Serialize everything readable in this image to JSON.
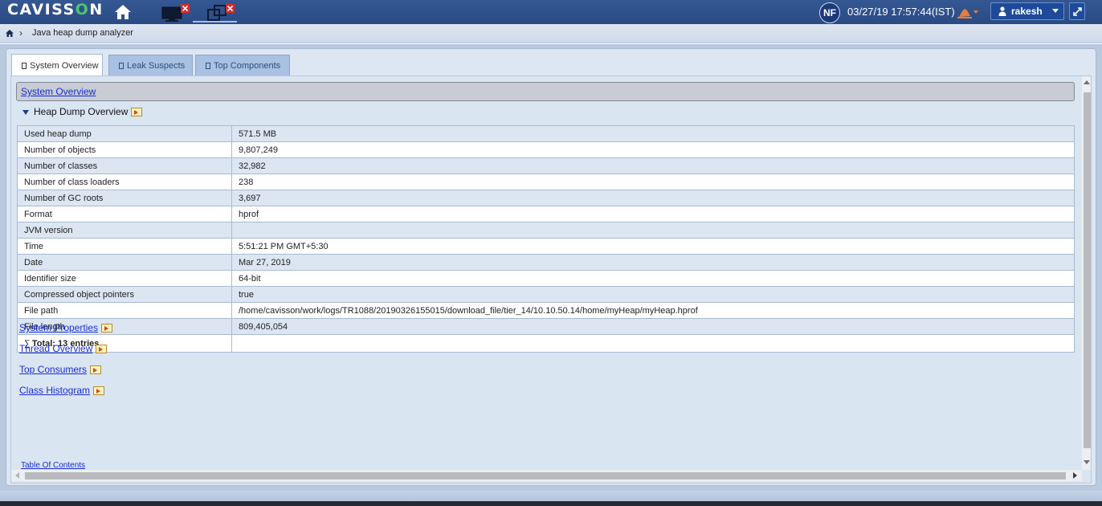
{
  "header": {
    "logo_prefix": "CAVISS",
    "logo_o": "O",
    "logo_suffix": "N",
    "badge": "NF",
    "datetime": "03/27/19 17:57:44(IST)",
    "user": "rakesh"
  },
  "breadcrumb": {
    "page": "Java heap dump analyzer"
  },
  "tabs": [
    {
      "label": "System Overview",
      "active": true
    },
    {
      "label": "Leak Suspects",
      "active": false
    },
    {
      "label": "Top Components",
      "active": false
    }
  ],
  "main": {
    "section_title": "System Overview",
    "subheading": "Heap Dump Overview",
    "rows": [
      {
        "key": "Used heap dump",
        "value": "571.5 MB"
      },
      {
        "key": "Number of objects",
        "value": "9,807,249"
      },
      {
        "key": "Number of classes",
        "value": "32,982"
      },
      {
        "key": "Number of class loaders",
        "value": "238"
      },
      {
        "key": "Number of GC roots",
        "value": "3,697"
      },
      {
        "key": "Format",
        "value": "hprof"
      },
      {
        "key": "JVM version",
        "value": ""
      },
      {
        "key": "Time",
        "value": "5:51:21 PM GMT+5:30"
      },
      {
        "key": "Date",
        "value": "Mar 27, 2019"
      },
      {
        "key": "Identifier size",
        "value": "64-bit"
      },
      {
        "key": "Compressed object pointers",
        "value": "true"
      },
      {
        "key": "File path",
        "value": "/home/cavisson/work/logs/TR1088/20190326155015/download_file/tier_14/10.10.50.14/home/myHeap/myHeap.hprof"
      },
      {
        "key": "File length",
        "value": "809,405,054"
      }
    ],
    "total_symbol": "∑",
    "total": "Total: 13 entries",
    "links": [
      "System Properties",
      "Thread Overview",
      "Top Consumers",
      "Class Histogram"
    ],
    "toc": "Table Of Contents"
  }
}
